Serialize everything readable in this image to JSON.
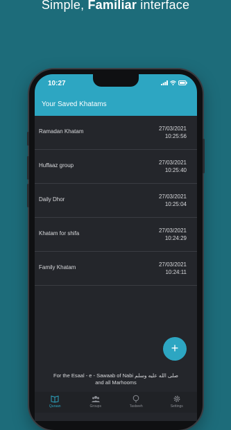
{
  "headline": {
    "plain": "Simple, ",
    "bold": "Familiar",
    "rest": " interface"
  },
  "status_bar": {
    "time": "10:27"
  },
  "app_bar": {
    "title": "Your Saved Khatams"
  },
  "khatams": [
    {
      "name": "Ramadan Khatam",
      "date": "27/03/2021",
      "time": "10:25:56"
    },
    {
      "name": "Huffaaz group",
      "date": "27/03/2021",
      "time": "10:25:40"
    },
    {
      "name": "Daily Dhor",
      "date": "27/03/2021",
      "time": "10:25:04"
    },
    {
      "name": "Khatam for shifa",
      "date": "27/03/2021",
      "time": "10:24:29"
    },
    {
      "name": "Family Khatam",
      "date": "27/03/2021",
      "time": "10:24:11"
    }
  ],
  "fab": {
    "symbol": "+"
  },
  "footer": {
    "line1": "For the Esaal - e - Sawaab of Nabi صلى الله عليه وسلم",
    "line2": "and all Marhooms"
  },
  "bottom_nav": [
    {
      "label": "Quraan",
      "icon": "book-icon",
      "active": true
    },
    {
      "label": "Groups",
      "icon": "people-icon",
      "active": false
    },
    {
      "label": "Tasbeeh",
      "icon": "tasbeeh-icon",
      "active": false
    },
    {
      "label": "Settings",
      "icon": "gear-icon",
      "active": false
    }
  ],
  "colors": {
    "accent": "#2da6c2",
    "background": "#1d6c7a",
    "screen": "#24262b"
  }
}
